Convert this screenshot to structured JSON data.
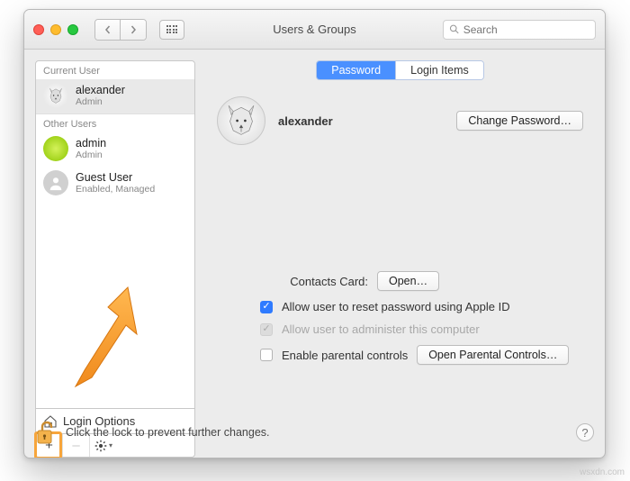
{
  "window": {
    "title": "Users & Groups",
    "search_placeholder": "Search"
  },
  "sidebar": {
    "current_user_header": "Current User",
    "other_users_header": "Other Users",
    "users": [
      {
        "name": "alexander",
        "sub": "Admin"
      },
      {
        "name": "admin",
        "sub": "Admin"
      },
      {
        "name": "Guest User",
        "sub": "Enabled, Managed"
      }
    ],
    "login_options_label": "Login Options",
    "add_label": "+",
    "remove_label": "–"
  },
  "tabs": {
    "password": "Password",
    "login_items": "Login Items"
  },
  "main": {
    "username": "alexander",
    "change_password": "Change Password…",
    "contacts_card_label": "Contacts Card:",
    "open_button": "Open…",
    "allow_reset": "Allow user to reset password using Apple ID",
    "allow_admin": "Allow user to administer this computer",
    "enable_parental": "Enable parental controls",
    "open_parental": "Open Parental Controls…"
  },
  "footer": {
    "lock_message": "Click the lock to prevent further changes."
  },
  "watermark": "wsxdn.com"
}
